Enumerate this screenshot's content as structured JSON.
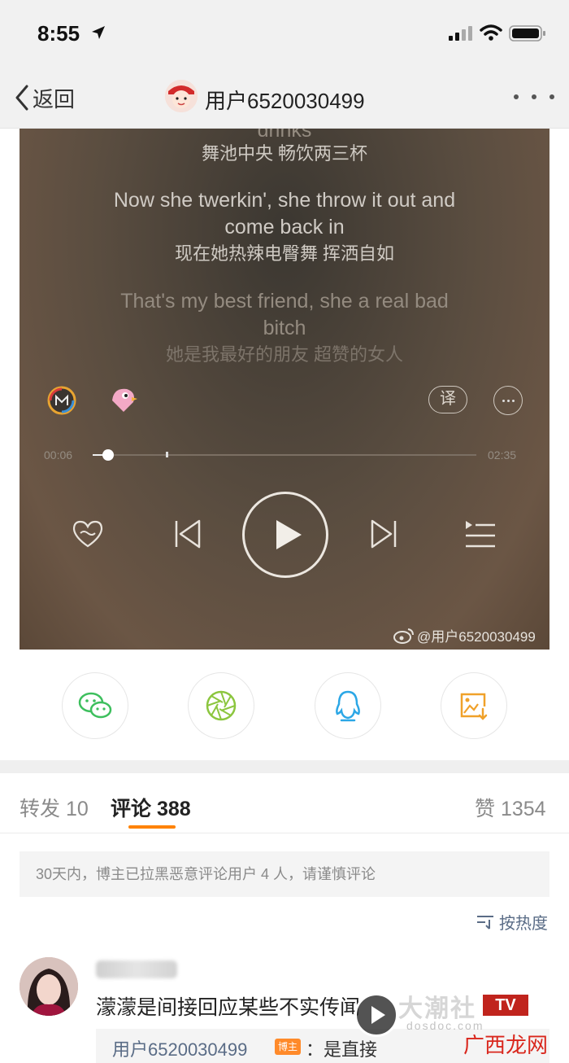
{
  "status_bar": {
    "time": "8:55"
  },
  "nav": {
    "back_label": "返回",
    "username": "用户6520030499"
  },
  "player": {
    "lyrics": [
      {
        "en": "drinks",
        "zh": "舞池中央 畅饮两三杯"
      },
      {
        "en_line1": "Now she twerkin', she throw it out and",
        "en_line2": "come back in",
        "zh": "现在她热辣电臀舞 挥洒自如"
      },
      {
        "en_line1": "That's my best friend, she a real bad",
        "en_line2": "bitch",
        "zh": "她是我最好的朋友 超赞的女人"
      }
    ],
    "translate_label": "译",
    "current_time": "00:06",
    "total_time": "02:35",
    "progress_fraction": 0.04,
    "watermark": "@用户6520030499"
  },
  "tabs": {
    "repost_label": "转发 10",
    "comment_label": "评论 388",
    "like_label": "赞 1354"
  },
  "notice": "30天内，博主已拉黑恶意评论用户 4 人，请谨慎评论",
  "sort_label": "按热度",
  "comment": {
    "text": "濛濛是间接回应某些不实传闻",
    "reply_user": "用户6520030499",
    "reply_badge": "博主",
    "reply_text": "：是直接"
  },
  "overlay": {
    "logo": "大潮社",
    "tv": "TV",
    "sub": "dosdoc.com",
    "site": "广西龙网"
  },
  "colors": {
    "accent": "#ff8200",
    "link": "#5a6c86",
    "tv_red": "#c0241d",
    "wechat_green": "#3dbf5d",
    "qq_blue": "#2ba7e6",
    "save_orange": "#f0a12a"
  }
}
